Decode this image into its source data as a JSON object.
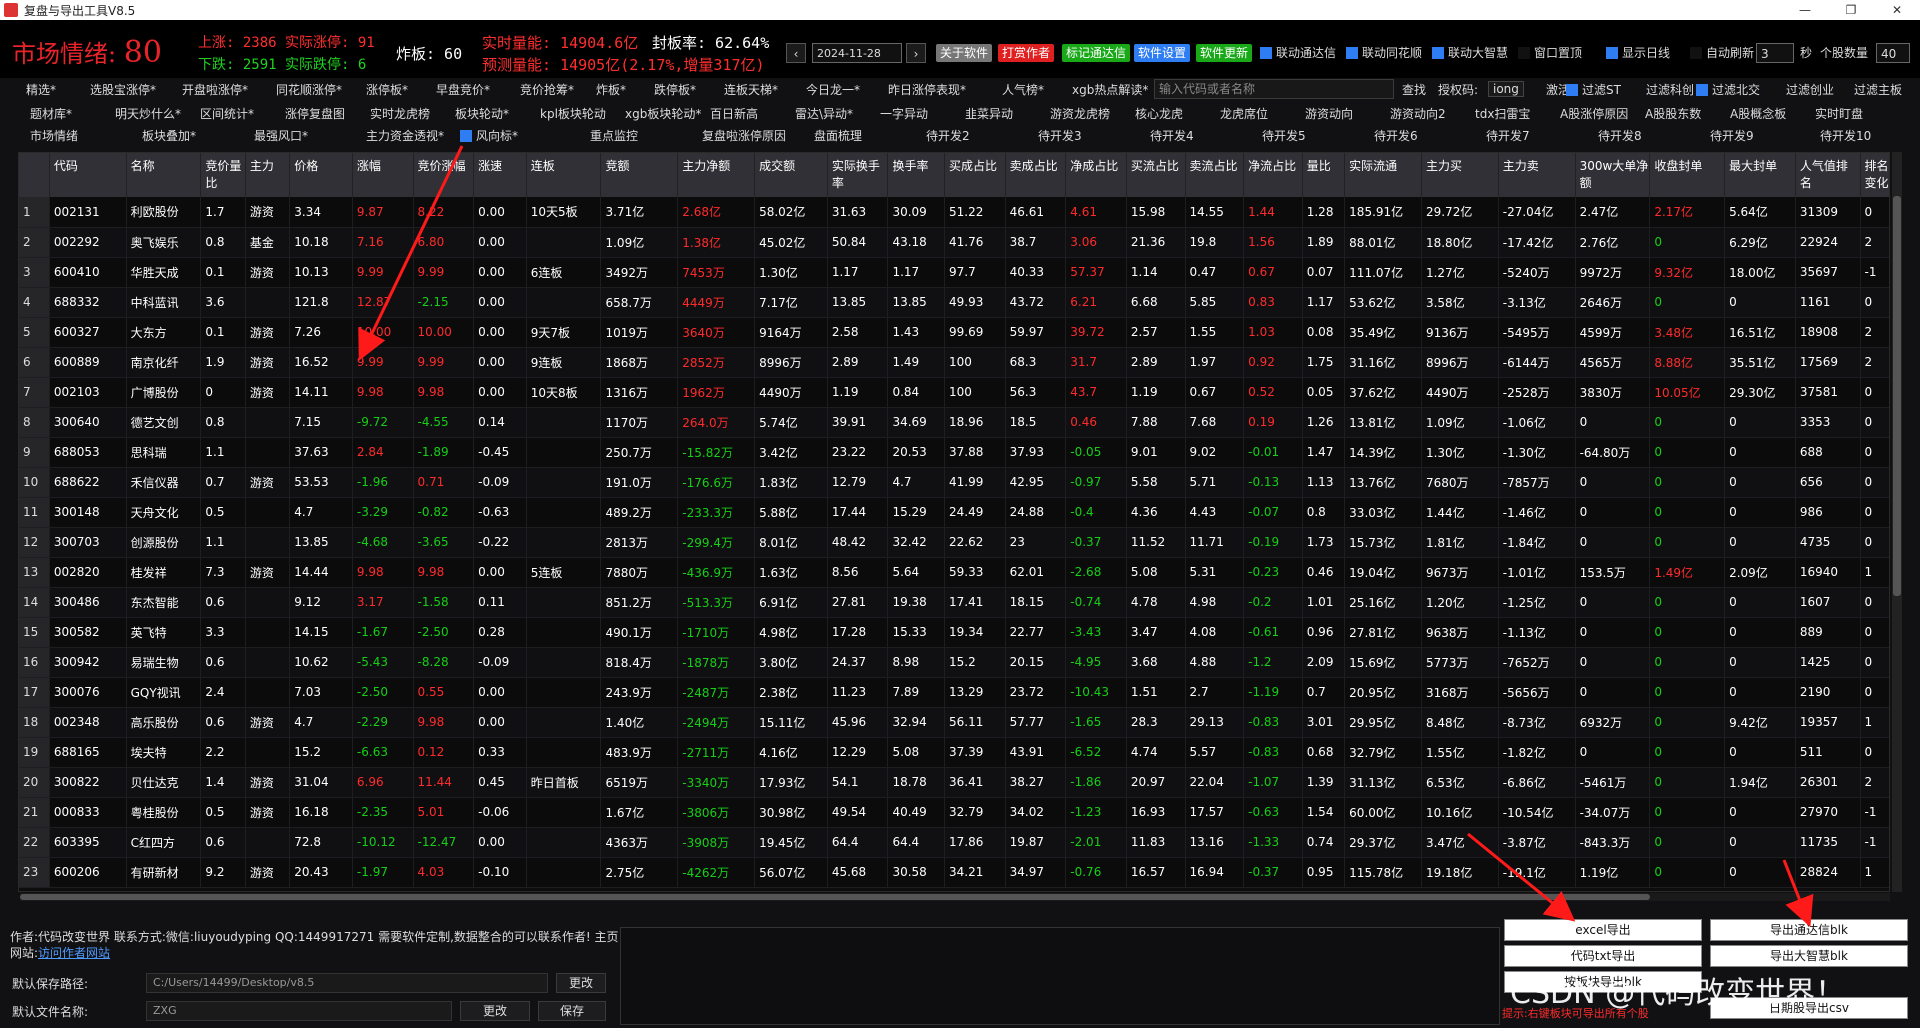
{
  "window": {
    "title": "复盘与导出工具V8.5",
    "btn_min": "—",
    "btn_max": "❐",
    "btn_close": "✕"
  },
  "header": {
    "mood_label": "市场情绪:",
    "mood_value": "80",
    "up_line": "上涨: 2386 实际涨停: 91",
    "down_line": "下跌: 2591 实际跌停: 6",
    "zhaban": "炸板: 60",
    "realtime_vol": "实时量能: 14904.6亿",
    "seal_rate": "封板率: 62.64%",
    "predict_vol": "预测量能: 14905亿(2.17%,增量317亿)",
    "prev_btn": "‹",
    "date": "2024-11-28",
    "next_btn": "›",
    "about_btn": "关于软件",
    "author_btn": "打赏作者",
    "mark_btn": "标记通达信",
    "settings_btn": "软件设置",
    "update_btn": "软件更新",
    "link_tdx": "联动通达信",
    "link_ths": "联动同花顺",
    "link_dzh": "联动大智慧",
    "window_top": "窗口置顶",
    "show_kline": "显示日线",
    "auto_refresh": "自动刷新",
    "refresh_secs": "3",
    "secs_unit": "秒",
    "stock_count_label": "个股数量",
    "stock_count": "40"
  },
  "toolbar1": [
    "精选*",
    "选股宝涨停*",
    "开盘啦涨停*",
    "同花顺涨停*",
    "涨停板*",
    "早盘竞价*",
    "竞价抢筹*",
    "炸板*",
    "跌停板*",
    "连板天梯*",
    "今日龙一*",
    "昨日涨停表现*",
    "人气榜*",
    "xgb热点解读*"
  ],
  "search": {
    "placeholder": "输入代码或者名称",
    "btn": "查找",
    "auth_label": "授权码:",
    "auth_value": "iong",
    "activate": "激活"
  },
  "filters": [
    "过滤ST",
    "过滤科创",
    "过滤北交",
    "过滤创业",
    "过滤主板"
  ],
  "toolbar2": [
    "题材库*",
    "明天炒什么*",
    "区间统计*",
    "涨停复盘图",
    "实时龙虎榜",
    "板块轮动*",
    "kpl板块轮动",
    "xgb板块轮动*",
    "百日新高",
    "雷达\\异动*",
    "一字异动",
    "韭菜异动",
    "游资龙虎榜",
    "核心龙虎",
    "龙虎席位",
    "游资动向",
    "游资动向2",
    "tdx扫雷宝",
    "A股涨停原因",
    "A股股东数",
    "A股概念板",
    "实时盯盘"
  ],
  "toolbar3": [
    "市场情绪",
    "板块叠加*",
    "最强风口*",
    "主力资金透视*",
    "风向标*",
    "重点监控",
    "复盘啦涨停原因",
    "盘面梳理",
    "待开发2",
    "待开发3",
    "待开发4",
    "待开发5",
    "待开发6",
    "待开发7",
    "待开发8",
    "待开发9",
    "待开发10"
  ],
  "columns": [
    "代码",
    "名称",
    "竞价量比",
    "主力",
    "价格",
    "涨幅",
    "竞价涨幅",
    "涨速",
    "连板",
    "竞额",
    "主力净额",
    "成交额",
    "实际换手率",
    "换手率",
    "买成占比",
    "卖成占比",
    "净成占比",
    "买流占比",
    "卖流占比",
    "净流占比",
    "量比",
    "实际流通",
    "主力买",
    "主力卖",
    "300w大单净额",
    "收盘封单",
    "最大封单",
    "人气值排名",
    "排名变化"
  ],
  "rows": [
    [
      "1",
      "002131",
      "利欧股份",
      "1.7",
      "游资",
      "3.34",
      "9.87",
      "8.22",
      "0.00",
      "10天5板",
      "3.71亿",
      "2.68亿",
      "58.02亿",
      "31.63",
      "30.09",
      "51.22",
      "46.61",
      "4.61",
      "15.98",
      "14.55",
      "1.44",
      "1.28",
      "185.91亿",
      "29.72亿",
      "-27.04亿",
      "2.47亿",
      "2.17亿",
      "5.64亿",
      "31309",
      "0"
    ],
    [
      "2",
      "002292",
      "奥飞娱乐",
      "0.8",
      "基金",
      "10.18",
      "7.16",
      "6.80",
      "0.00",
      "",
      "1.09亿",
      "1.38亿",
      "45.02亿",
      "50.84",
      "43.18",
      "41.76",
      "38.7",
      "3.06",
      "21.36",
      "19.8",
      "1.56",
      "1.89",
      "88.01亿",
      "18.80亿",
      "-17.42亿",
      "2.76亿",
      "0",
      "6.29亿",
      "22924",
      "2"
    ],
    [
      "3",
      "600410",
      "华胜天成",
      "0.1",
      "游资",
      "10.13",
      "9.99",
      "9.99",
      "0.00",
      "6连板",
      "3492万",
      "7453万",
      "1.30亿",
      "1.17",
      "1.17",
      "97.7",
      "40.33",
      "57.37",
      "1.14",
      "0.47",
      "0.67",
      "0.07",
      "111.07亿",
      "1.27亿",
      "-5240万",
      "9972万",
      "9.32亿",
      "18.00亿",
      "35697",
      "-1"
    ],
    [
      "4",
      "688332",
      "中科蓝讯",
      "3.6",
      "",
      "121.8",
      "12.87",
      "-2.15",
      "0.00",
      "",
      "658.7万",
      "4449万",
      "7.17亿",
      "13.85",
      "13.85",
      "49.93",
      "43.72",
      "6.21",
      "6.68",
      "5.85",
      "0.83",
      "1.17",
      "53.62亿",
      "3.58亿",
      "-3.13亿",
      "2646万",
      "0",
      "0",
      "1161",
      "0"
    ],
    [
      "5",
      "600327",
      "大东方",
      "0.1",
      "游资",
      "7.26",
      "10.00",
      "10.00",
      "0.00",
      "9天7板",
      "1019万",
      "3640万",
      "9164万",
      "2.58",
      "1.43",
      "99.69",
      "59.97",
      "39.72",
      "2.57",
      "1.55",
      "1.03",
      "0.08",
      "35.49亿",
      "9136万",
      "-5495万",
      "4599万",
      "3.48亿",
      "16.51亿",
      "18908",
      "2"
    ],
    [
      "6",
      "600889",
      "南京化纤",
      "1.9",
      "游资",
      "16.52",
      "9.99",
      "9.99",
      "0.00",
      "9连板",
      "1868万",
      "2852万",
      "8996万",
      "2.89",
      "1.49",
      "100",
      "68.3",
      "31.7",
      "2.89",
      "1.97",
      "0.92",
      "1.75",
      "31.16亿",
      "8996万",
      "-6144万",
      "4565万",
      "8.88亿",
      "35.51亿",
      "17569",
      "2"
    ],
    [
      "7",
      "002103",
      "广博股份",
      "0",
      "游资",
      "14.11",
      "9.98",
      "9.98",
      "0.00",
      "10天8板",
      "1316万",
      "1962万",
      "4490万",
      "1.19",
      "0.84",
      "100",
      "56.3",
      "43.7",
      "1.19",
      "0.67",
      "0.52",
      "0.05",
      "37.62亿",
      "4490万",
      "-2528万",
      "3830万",
      "10.05亿",
      "29.30亿",
      "37581",
      "0"
    ],
    [
      "8",
      "300640",
      "德艺文创",
      "0.8",
      "",
      "7.15",
      "-9.72",
      "-4.55",
      "0.14",
      "",
      "1170万",
      "264.0万",
      "5.74亿",
      "39.91",
      "34.69",
      "18.96",
      "18.5",
      "0.46",
      "7.88",
      "7.68",
      "0.19",
      "1.26",
      "13.81亿",
      "1.09亿",
      "-1.06亿",
      "0",
      "0",
      "0",
      "3353",
      "0"
    ],
    [
      "9",
      "688053",
      "思科瑞",
      "1.1",
      "",
      "37.63",
      "2.84",
      "-1.89",
      "-0.45",
      "",
      "250.7万",
      "-15.82万",
      "3.42亿",
      "23.22",
      "20.53",
      "37.88",
      "37.93",
      "-0.05",
      "9.01",
      "9.02",
      "-0.01",
      "1.47",
      "14.39亿",
      "1.30亿",
      "-1.30亿",
      "-64.80万",
      "0",
      "0",
      "688",
      "0"
    ],
    [
      "10",
      "688622",
      "禾信仪器",
      "0.7",
      "游资",
      "53.53",
      "-1.96",
      "0.71",
      "-0.09",
      "",
      "191.0万",
      "-176.6万",
      "1.83亿",
      "12.79",
      "4.7",
      "41.99",
      "42.95",
      "-0.97",
      "5.58",
      "5.71",
      "-0.13",
      "1.13",
      "13.76亿",
      "7680万",
      "-7857万",
      "0",
      "0",
      "0",
      "656",
      "0"
    ],
    [
      "11",
      "300148",
      "天舟文化",
      "0.5",
      "",
      "4.7",
      "-3.29",
      "-0.82",
      "-0.63",
      "",
      "489.2万",
      "-233.3万",
      "5.88亿",
      "17.44",
      "15.29",
      "24.49",
      "24.88",
      "-0.4",
      "4.36",
      "4.43",
      "-0.07",
      "0.8",
      "33.03亿",
      "1.44亿",
      "-1.46亿",
      "0",
      "0",
      "0",
      "986",
      "0"
    ],
    [
      "12",
      "300703",
      "创源股份",
      "1.1",
      "",
      "13.85",
      "-4.68",
      "-3.65",
      "-0.22",
      "",
      "2813万",
      "-299.4万",
      "8.01亿",
      "48.42",
      "32.42",
      "22.62",
      "23",
      "-0.37",
      "11.52",
      "11.71",
      "-0.19",
      "1.73",
      "15.73亿",
      "1.81亿",
      "-1.84亿",
      "0",
      "0",
      "0",
      "4735",
      "0"
    ],
    [
      "13",
      "002820",
      "桂发祥",
      "7.3",
      "游资",
      "14.44",
      "9.98",
      "9.98",
      "0.00",
      "5连板",
      "7880万",
      "-436.9万",
      "1.63亿",
      "8.56",
      "5.64",
      "59.33",
      "62.01",
      "-2.68",
      "5.08",
      "5.31",
      "-0.23",
      "0.46",
      "19.04亿",
      "9673万",
      "-1.01亿",
      "153.5万",
      "1.49亿",
      "2.09亿",
      "16940",
      "1"
    ],
    [
      "14",
      "300486",
      "东杰智能",
      "0.6",
      "",
      "9.12",
      "3.17",
      "-1.58",
      "0.11",
      "",
      "851.2万",
      "-513.3万",
      "6.91亿",
      "27.81",
      "19.38",
      "17.41",
      "18.15",
      "-0.74",
      "4.78",
      "4.98",
      "-0.2",
      "1.01",
      "25.16亿",
      "1.20亿",
      "-1.25亿",
      "0",
      "0",
      "0",
      "1607",
      "0"
    ],
    [
      "15",
      "300582",
      "英飞特",
      "3.3",
      "",
      "14.15",
      "-1.67",
      "-2.50",
      "0.28",
      "",
      "490.1万",
      "-1710万",
      "4.98亿",
      "17.28",
      "15.33",
      "19.34",
      "22.77",
      "-3.43",
      "3.47",
      "4.08",
      "-0.61",
      "0.96",
      "27.81亿",
      "9638万",
      "-1.13亿",
      "0",
      "0",
      "0",
      "889",
      "0"
    ],
    [
      "16",
      "300942",
      "易瑞生物",
      "0.6",
      "",
      "10.62",
      "-5.43",
      "-8.28",
      "-0.09",
      "",
      "818.4万",
      "-1878万",
      "3.80亿",
      "24.37",
      "8.98",
      "15.2",
      "20.15",
      "-4.95",
      "3.68",
      "4.88",
      "-1.2",
      "2.09",
      "15.69亿",
      "5773万",
      "-7652万",
      "0",
      "0",
      "0",
      "1425",
      "0"
    ],
    [
      "17",
      "300076",
      "GQY视讯",
      "2.4",
      "",
      "7.03",
      "-2.50",
      "0.55",
      "0.00",
      "",
      "243.9万",
      "-2487万",
      "2.38亿",
      "11.23",
      "7.89",
      "13.29",
      "23.72",
      "-10.43",
      "1.51",
      "2.7",
      "-1.19",
      "0.7",
      "20.95亿",
      "3168万",
      "-5656万",
      "0",
      "0",
      "0",
      "2190",
      "0"
    ],
    [
      "18",
      "002348",
      "高乐股份",
      "0.6",
      "游资",
      "4.7",
      "-2.29",
      "9.98",
      "0.00",
      "",
      "1.40亿",
      "-2494万",
      "15.11亿",
      "45.96",
      "32.94",
      "56.11",
      "57.77",
      "-1.65",
      "28.3",
      "29.13",
      "-0.83",
      "3.01",
      "29.95亿",
      "8.48亿",
      "-8.73亿",
      "6932万",
      "0",
      "9.42亿",
      "19357",
      "1"
    ],
    [
      "19",
      "688165",
      "埃夫特",
      "2.2",
      "",
      "15.2",
      "-6.63",
      "0.12",
      "0.33",
      "",
      "483.9万",
      "-2711万",
      "4.16亿",
      "12.29",
      "5.08",
      "37.39",
      "43.91",
      "-6.52",
      "4.74",
      "5.57",
      "-0.83",
      "0.68",
      "32.79亿",
      "1.55亿",
      "-1.82亿",
      "0",
      "0",
      "0",
      "511",
      "0"
    ],
    [
      "20",
      "300822",
      "贝仕达克",
      "1.4",
      "游资",
      "31.04",
      "6.96",
      "11.44",
      "0.45",
      "昨日首板",
      "6519万",
      "-3340万",
      "17.93亿",
      "54.1",
      "18.78",
      "36.41",
      "38.27",
      "-1.86",
      "20.97",
      "22.04",
      "-1.07",
      "1.39",
      "31.13亿",
      "6.53亿",
      "-6.86亿",
      "-5461万",
      "0",
      "1.94亿",
      "26301",
      "2"
    ],
    [
      "21",
      "000833",
      "粤桂股份",
      "0.5",
      "游资",
      "16.18",
      "-2.35",
      "5.01",
      "-0.06",
      "",
      "1.67亿",
      "-3806万",
      "30.98亿",
      "49.54",
      "40.49",
      "32.79",
      "34.02",
      "-1.23",
      "16.93",
      "17.57",
      "-0.63",
      "1.54",
      "60.00亿",
      "10.16亿",
      "-10.54亿",
      "-34.07万",
      "0",
      "0",
      "27970",
      "-1"
    ],
    [
      "22",
      "603395",
      "C红四方",
      "0.6",
      "",
      "72.8",
      "-10.12",
      "-12.47",
      "0.00",
      "",
      "4363万",
      "-3908万",
      "19.45亿",
      "64.4",
      "64.4",
      "17.86",
      "19.87",
      "-2.01",
      "11.83",
      "13.16",
      "-1.33",
      "0.74",
      "29.37亿",
      "3.47亿",
      "-3.87亿",
      "-843.3万",
      "0",
      "0",
      "11735",
      "-1"
    ],
    [
      "23",
      "600206",
      "有研新材",
      "9.2",
      "游资",
      "20.43",
      "-1.97",
      "4.03",
      "-0.10",
      "",
      "2.75亿",
      "-4262万",
      "56.07亿",
      "45.68",
      "30.58",
      "34.21",
      "34.97",
      "-0.76",
      "16.57",
      "16.94",
      "-0.37",
      "0.95",
      "115.78亿",
      "19.18亿",
      "-19.1亿",
      "1.19亿",
      "0",
      "0",
      "28824",
      "1"
    ]
  ],
  "footer": {
    "author": "作者:代码改变世界 联系方式:微信:liuyoudyping QQ:1449917271 需要软件定制,数据整合的可以联系作者! 主页网站:",
    "author_link": "访问作者网站",
    "save_path_label": "默认保存路径:",
    "save_path": "C:/Users/14499/Desktop/v8.5",
    "change_btn": "更改",
    "file_name_label": "默认文件名称:",
    "file_name": "ZXG",
    "change_btn2": "更改",
    "save_btn": "保存",
    "export_excel": "excel导出",
    "export_tdx_blk": "导出通达信blk",
    "export_code_txt": "代码txt导出",
    "export_dzh_blk": "导出大智慧blk",
    "export_sector_blk": "按板块导出blk",
    "export_csv": "日期股导出csv",
    "hint": "提示:右键板块可导出所有个股"
  },
  "watermark": "CSDN @代码改变世界！",
  "colors": {
    "up": "#ff2e2e",
    "down": "#1fd11f",
    "accent": "#2e7df2"
  }
}
